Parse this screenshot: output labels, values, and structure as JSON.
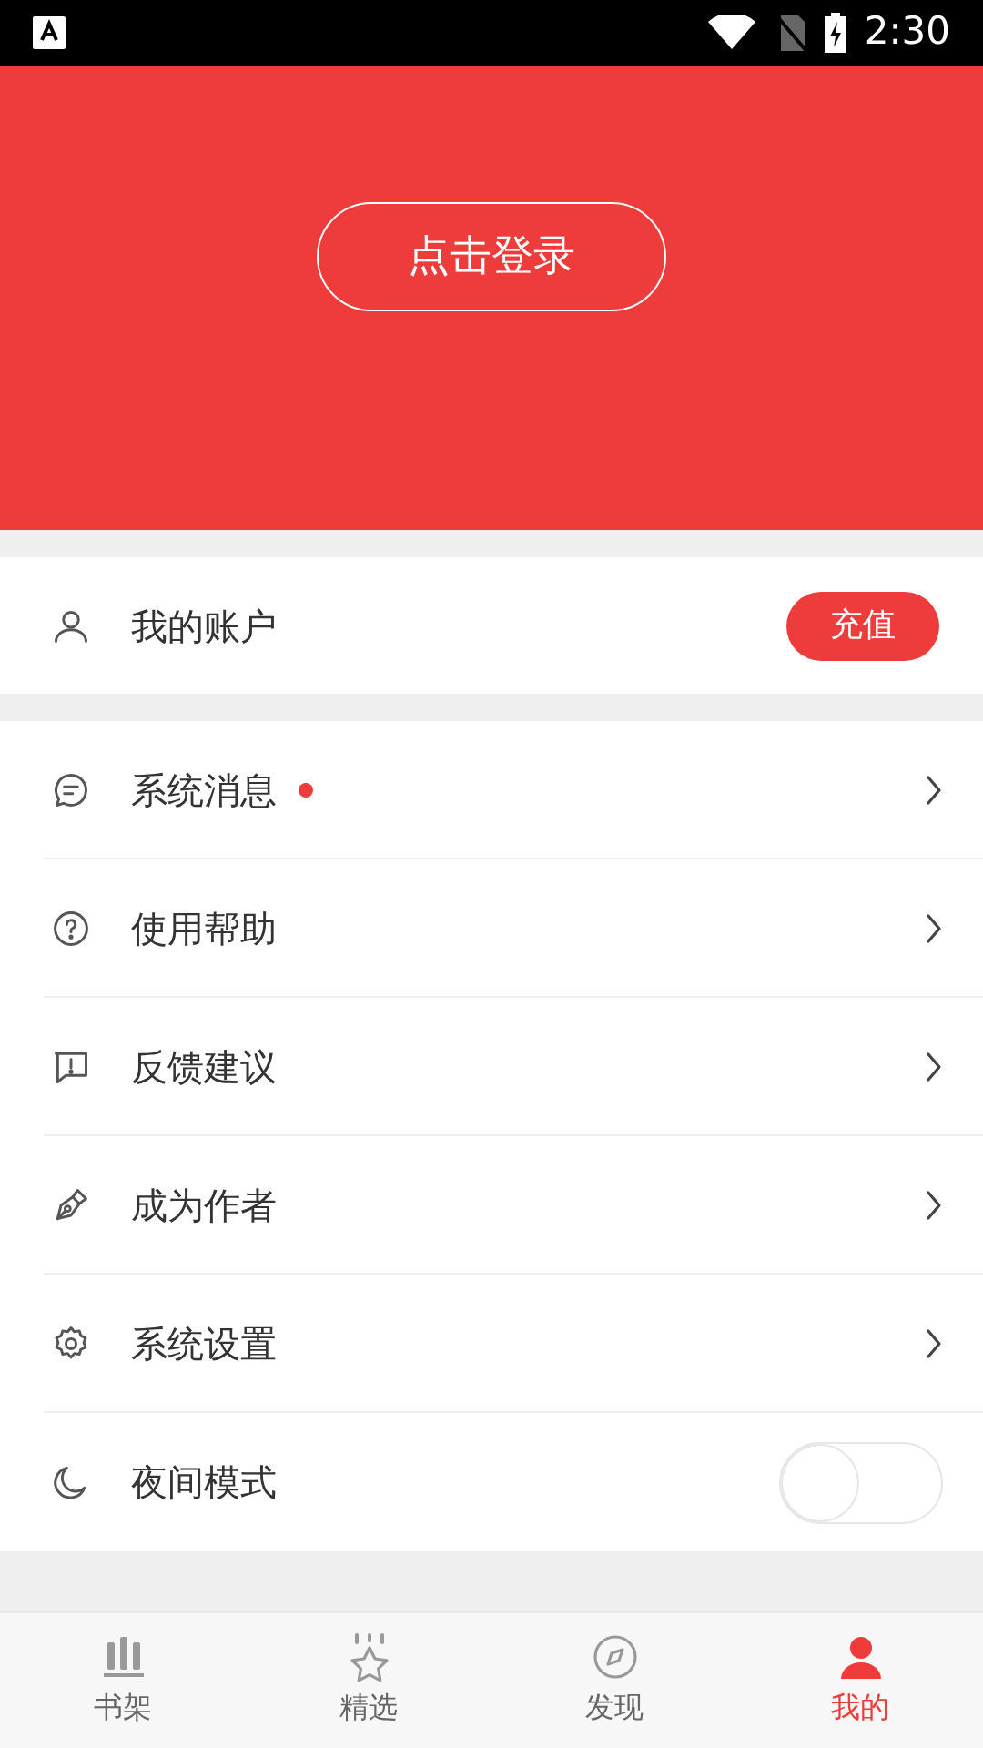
{
  "status_bar": {
    "time": "2:30"
  },
  "header": {
    "login_button": "点击登录"
  },
  "account": {
    "label": "我的账户",
    "action": "充值"
  },
  "menu": [
    {
      "kind": "link",
      "label": "系统消息",
      "badge": true
    },
    {
      "kind": "link",
      "label": "使用帮助",
      "badge": false
    },
    {
      "kind": "link",
      "label": "反馈建议",
      "badge": false
    },
    {
      "kind": "link",
      "label": "成为作者",
      "badge": false
    },
    {
      "kind": "link",
      "label": "系统设置",
      "badge": false
    },
    {
      "kind": "toggle",
      "label": "夜间模式",
      "on": false
    }
  ],
  "bottom_nav": [
    {
      "label": "书架",
      "selected": false
    },
    {
      "label": "精选",
      "selected": false
    },
    {
      "label": "发现",
      "selected": false
    },
    {
      "label": "我的",
      "selected": true
    }
  ]
}
